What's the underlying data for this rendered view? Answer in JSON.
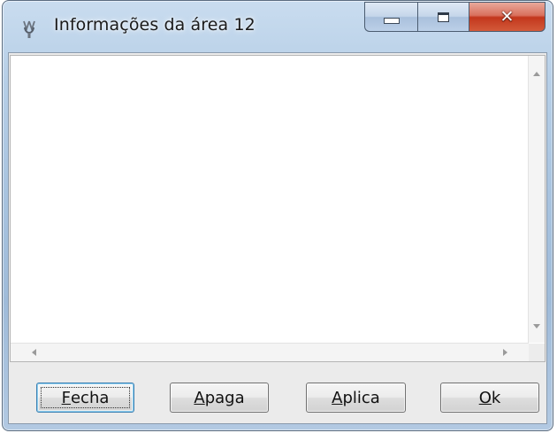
{
  "window": {
    "title": "Informações da área 12"
  },
  "caption_buttons": {
    "minimize": "minimize-icon",
    "maximize": "maximize-icon",
    "close_glyph": "x"
  },
  "text_area": {
    "value": ""
  },
  "buttons": [
    {
      "accel": "F",
      "rest": "echa"
    },
    {
      "accel": "A",
      "rest": "paga"
    },
    {
      "accel": "A",
      "rest": "plica"
    },
    {
      "accel": "O",
      "rest": "k"
    }
  ],
  "colors": {
    "close_button": "#c3371c",
    "frame": "#a8c3df",
    "default_button_border": "#3c7fb1"
  }
}
